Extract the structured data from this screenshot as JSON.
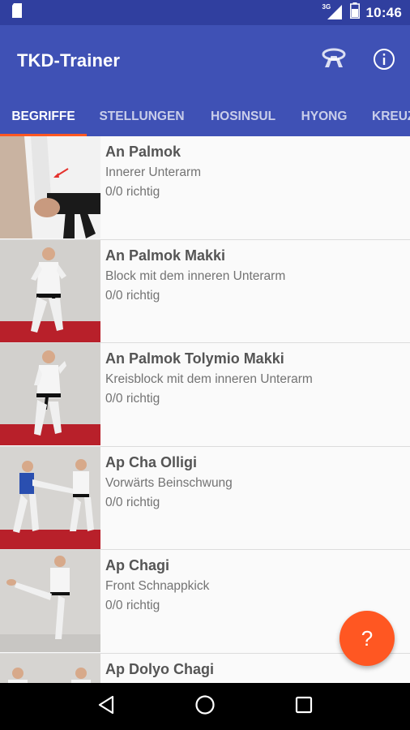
{
  "status_bar": {
    "network": "3G",
    "time": "10:46",
    "icons": [
      "sd-card-icon",
      "signal-icon",
      "battery-icon"
    ]
  },
  "app": {
    "title": "TKD-Trainer",
    "actions": [
      {
        "name": "belt-icon",
        "label": "Belt"
      },
      {
        "name": "info-icon",
        "label": "Info"
      }
    ]
  },
  "tabs": [
    {
      "label": "BEGRIFFE",
      "active": true
    },
    {
      "label": "STELLUNGEN",
      "active": false
    },
    {
      "label": "HOSINSUL",
      "active": false
    },
    {
      "label": "HYONG",
      "active": false
    },
    {
      "label": "KREUZ",
      "active": false
    }
  ],
  "items": [
    {
      "title": "An Palmok",
      "subtitle": "Innerer Unterarm",
      "score": "0/0 richtig"
    },
    {
      "title": "An Palmok Makki",
      "subtitle": "Block mit dem inneren Unterarm",
      "score": "0/0 richtig"
    },
    {
      "title": "An Palmok Tolymio Makki",
      "subtitle": "Kreisblock mit dem inneren Unterarm",
      "score": "0/0 richtig"
    },
    {
      "title": "Ap Cha Olligi",
      "subtitle": "Vorwärts Beinschwung",
      "score": "0/0 richtig"
    },
    {
      "title": "Ap Chagi",
      "subtitle": "Front Schnappkick",
      "score": "0/0 richtig"
    },
    {
      "title": "Ap Dolyo Chagi",
      "subtitle": "",
      "score": ""
    }
  ],
  "fab": {
    "label": "?"
  },
  "colors": {
    "primary": "#3f51b5",
    "primary_dark": "#303f9f",
    "accent": "#ff5722"
  }
}
